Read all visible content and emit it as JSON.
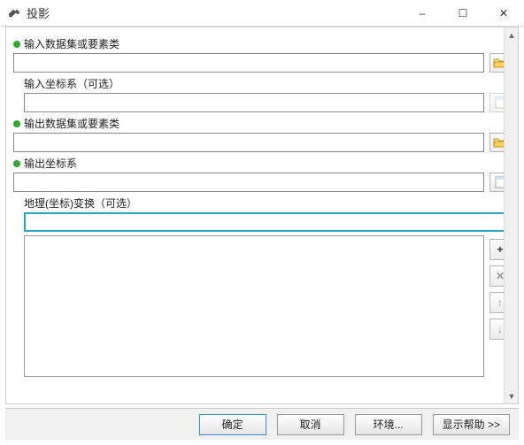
{
  "window": {
    "title": "投影"
  },
  "winbuttons": {
    "min": "–",
    "max": "☐",
    "close": "✕"
  },
  "fields": {
    "inputDataset": {
      "label": "输入数据集或要素类",
      "value": ""
    },
    "inputCS": {
      "label": "输入坐标系（可选）",
      "value": ""
    },
    "outputDataset": {
      "label": "输出数据集或要素类",
      "value": ""
    },
    "outputCS": {
      "label": "输出坐标系",
      "value": ""
    },
    "geoTransform": {
      "label": "地理(坐标)变换（可选）",
      "value": ""
    }
  },
  "icons": {
    "folderOpen": "folder-open-icon",
    "paper": "paper-icon",
    "add": "+",
    "remove": "✕",
    "up": "↑",
    "down": "↓"
  },
  "buttons": {
    "ok": "确定",
    "cancel": "取消",
    "env": "环境...",
    "help": "显示帮助 >>"
  }
}
